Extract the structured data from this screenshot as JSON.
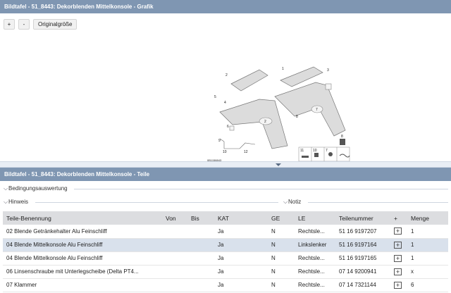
{
  "graphic_panel": {
    "title": "Bildtafel - 51_8443: Dekorblenden Mittelkonsole - Grafik",
    "buttons": {
      "zoom_in": "+",
      "zoom_out": "-",
      "original_size": "Originalgröße"
    },
    "diagram": {
      "callouts": [
        "1",
        "2",
        "3",
        "4",
        "5",
        "6",
        "7",
        "8",
        "9",
        "10",
        "11",
        "12"
      ],
      "code": "0B1158843"
    }
  },
  "parts_panel": {
    "title": "Bildtafel - 51_8443: Dekorblenden Mittelkonsole - Teile",
    "conditions_label": "Bedingungsauswertung",
    "hint_label": "Hinweis",
    "note_label": "Notiz",
    "columns": [
      "Teile-Benennung",
      "Von",
      "Bis",
      "KAT",
      "GE",
      "LE",
      "Teilenummer",
      "+",
      "Menge"
    ],
    "rows": [
      {
        "name": "02 Blende Getränkehalter Alu Feinschliff",
        "von": "",
        "bis": "",
        "kat": "Ja",
        "ge": "N",
        "le": "Rechtsle...",
        "teilenummer": "51 16 9197207",
        "plus": "+",
        "menge": "1"
      },
      {
        "name": "04 Blende Mittelkonsole Alu Feinschliff",
        "von": "",
        "bis": "",
        "kat": "Ja",
        "ge": "N",
        "le": "Linkslenker",
        "teilenummer": "51 16 9197164",
        "plus": "+",
        "menge": "1"
      },
      {
        "name": "04 Blende Mittelkonsole Alu Feinschliff",
        "von": "",
        "bis": "",
        "kat": "Ja",
        "ge": "N",
        "le": "Rechtsle...",
        "teilenummer": "51 16 9197165",
        "plus": "+",
        "menge": "1"
      },
      {
        "name": "06 Linsenschraube mit Unterlegscheibe (Delta PT4...",
        "von": "",
        "bis": "",
        "kat": "Ja",
        "ge": "N",
        "le": "Rechtsle...",
        "teilenummer": "07 14 9200941",
        "plus": "+",
        "menge": "x"
      },
      {
        "name": "07 Klammer",
        "von": "",
        "bis": "",
        "kat": "Ja",
        "ge": "N",
        "le": "Rechtsle...",
        "teilenummer": "07 14 7321144",
        "plus": "+",
        "menge": "6"
      }
    ]
  }
}
